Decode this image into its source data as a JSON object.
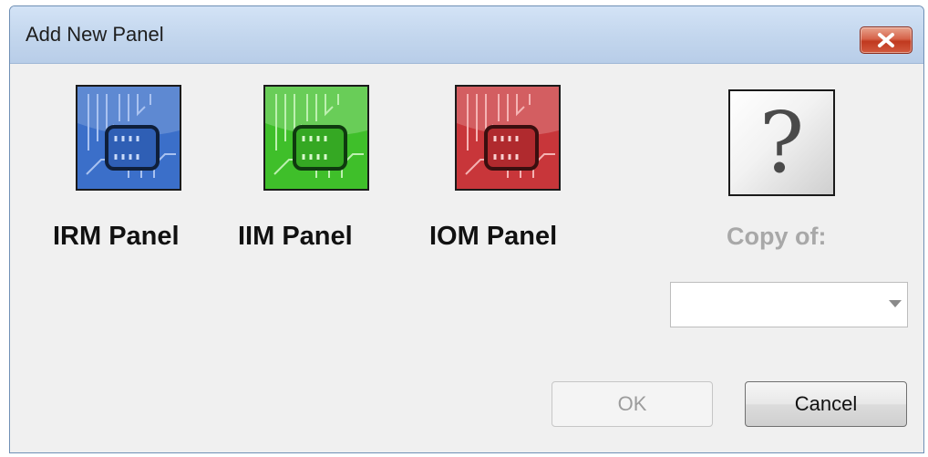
{
  "window": {
    "title": "Add New Panel",
    "close_icon": "close-icon"
  },
  "panels": [
    {
      "label": "IRM Panel",
      "icon": "irm-panel-icon",
      "color": "#3b6fc9"
    },
    {
      "label": "IIM Panel",
      "icon": "iim-panel-icon",
      "color": "#3fbf2a"
    },
    {
      "label": "IOM Panel",
      "icon": "iom-panel-icon",
      "color": "#c8363a"
    }
  ],
  "copy": {
    "icon": "question-mark-icon",
    "icon_text": "?",
    "label": "Copy of:",
    "selected_value": ""
  },
  "buttons": {
    "ok_label": "OK",
    "cancel_label": "Cancel"
  }
}
